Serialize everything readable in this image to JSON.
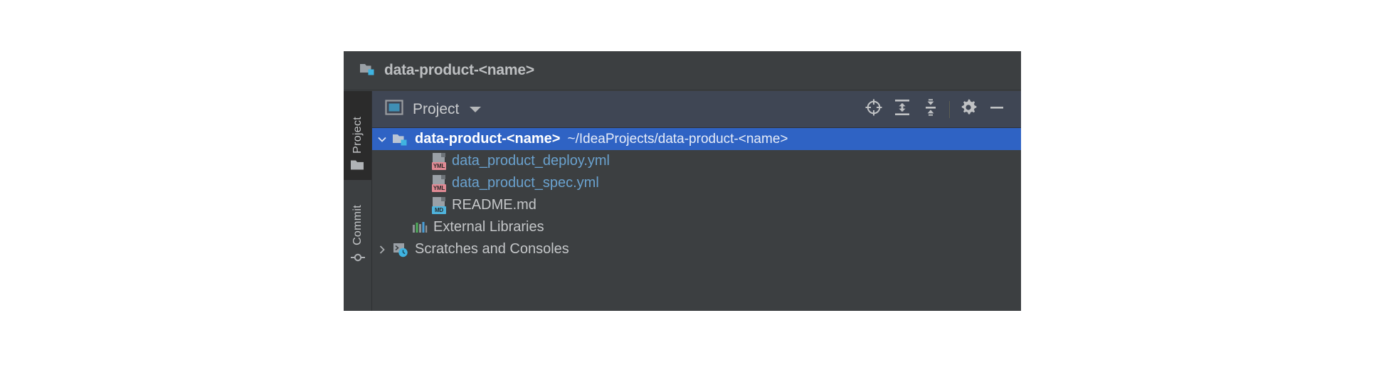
{
  "window": {
    "title": "data-product-<name>",
    "title_icon": "project-folder-icon"
  },
  "tool_strip": {
    "items": [
      {
        "label": "Project",
        "icon": "folder-icon",
        "selected": true
      },
      {
        "label": "Commit",
        "icon": "commit-icon",
        "selected": false
      }
    ]
  },
  "toolbar": {
    "selector_label": "Project",
    "selector_icon": "project-view-icon",
    "caret_icon": "chevron-down-icon",
    "actions": [
      {
        "name": "select-opened-file",
        "icon": "crosshair-target-icon",
        "tooltip": "Select Opened File"
      },
      {
        "name": "expand-all",
        "icon": "expand-all-icon",
        "tooltip": "Expand All"
      },
      {
        "name": "collapse-all",
        "icon": "collapse-all-icon",
        "tooltip": "Collapse All"
      },
      {
        "name": "settings",
        "icon": "gear-icon",
        "tooltip": "Options"
      },
      {
        "name": "hide",
        "icon": "minimize-icon",
        "tooltip": "Hide"
      }
    ]
  },
  "tree": {
    "rows": [
      {
        "label": "data-product-<name>",
        "path": "~/IdeaProjects/data-product-<name>",
        "icon": "project-folder-icon",
        "twisty": "chevron-down-icon",
        "indent": 0,
        "selected": true,
        "bold": true
      },
      {
        "label": "data_product_deploy.yml",
        "path": "",
        "icon": "yml-file-icon",
        "badge": "YML",
        "twisty": "",
        "indent": 2,
        "selected": false,
        "bold": false
      },
      {
        "label": "data_product_spec.yml",
        "path": "",
        "icon": "yml-file-icon",
        "badge": "YML",
        "twisty": "",
        "indent": 2,
        "selected": false,
        "bold": false
      },
      {
        "label": "README.md",
        "path": "",
        "icon": "md-file-icon",
        "badge": "MD",
        "twisty": "",
        "indent": 2,
        "selected": false,
        "bold": false
      },
      {
        "label": "External Libraries",
        "path": "",
        "icon": "external-libraries-icon",
        "twisty": "",
        "indent": 1,
        "selected": false,
        "bold": false
      },
      {
        "label": "Scratches and Consoles",
        "path": "",
        "icon": "scratches-consoles-icon",
        "twisty": "chevron-right-icon",
        "indent": 0,
        "selected": false,
        "bold": false
      }
    ]
  },
  "colors": {
    "panel_bg": "#3c3f41",
    "toolbar_bg": "#3f4654",
    "selection_blue": "#2f63c4",
    "strip_selected_bg": "#2b2b2b",
    "text_primary": "#c5c7c9",
    "yml_text": "#6aa2cf",
    "yml_badge": "#e08a94",
    "md_badge": "#4fb4dd",
    "folder_icon": "#9aa0a6",
    "accent_cyan": "#3fb3e0"
  }
}
